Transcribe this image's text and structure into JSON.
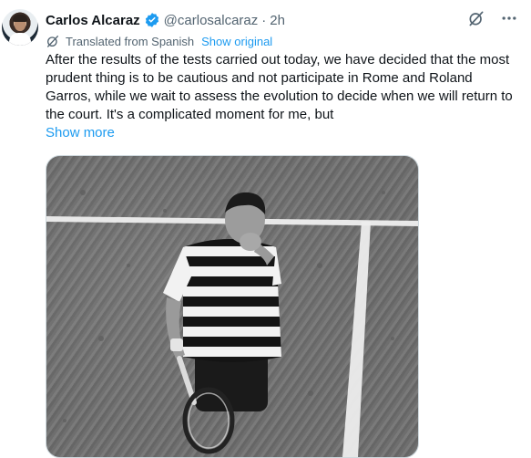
{
  "author": {
    "name": "Carlos Alcaraz",
    "handle": "@carlosalcaraz",
    "separator": "·",
    "time": "2h"
  },
  "translation": {
    "label": "Translated from Spanish",
    "link": "Show original"
  },
  "tweet": {
    "text": "After the results of the tests carried out today, we have decided that the most prudent thing is to be cautious and not participate in Rome and Roland Garros, while we wait to assess the evolution to decide when we will return to the court. It's a complicated moment for me, but",
    "show_more": "Show more"
  },
  "icons": {
    "verified": "verified-badge-icon",
    "grok": "grok-icon",
    "more": "more-options-icon",
    "translate": "translate-globe-icon"
  },
  "colors": {
    "accent": "#1d9bf0",
    "secondary_text": "#536471",
    "primary_text": "#0f1419"
  }
}
